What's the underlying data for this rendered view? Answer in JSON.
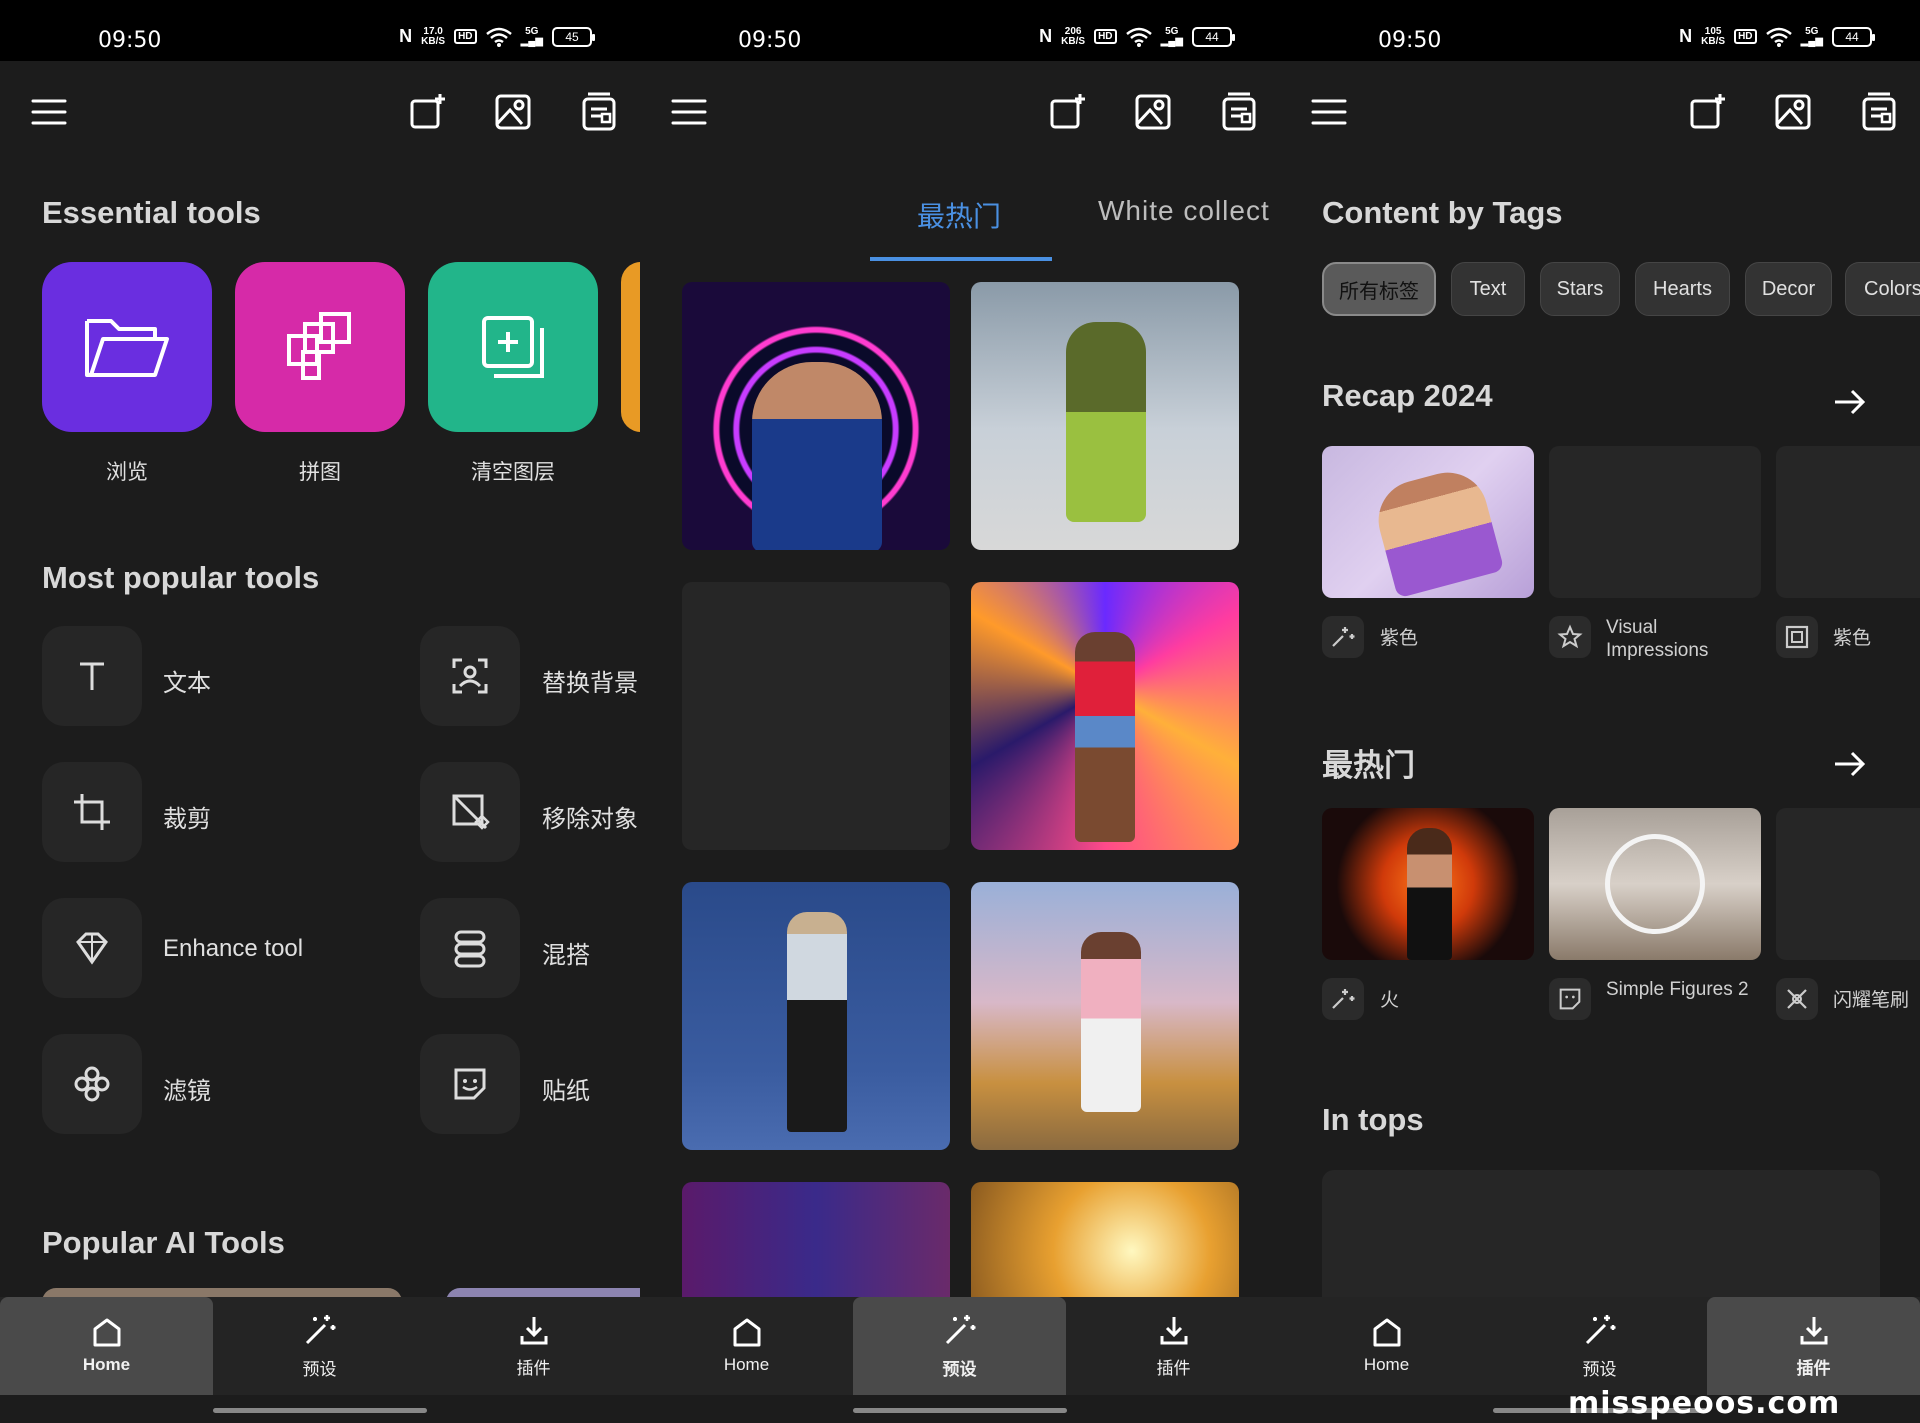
{
  "status_bars": [
    {
      "time": "09:50",
      "net_top": "17.0",
      "net_bottom": "KB/S",
      "battery": "45"
    },
    {
      "time": "09:50",
      "net_top": "206",
      "net_bottom": "KB/S",
      "battery": "44"
    },
    {
      "time": "09:50",
      "net_top": "105",
      "net_bottom": "KB/S",
      "battery": "44"
    }
  ],
  "status_labels": {
    "hd": "HD",
    "signal": "5G",
    "nfc": "N"
  },
  "icons": {
    "menu": "menu-icon",
    "new": "new-project-icon",
    "open_image": "open-image-icon",
    "projects": "projects-icon",
    "home": "home-icon",
    "presets": "magic-wand-icon",
    "plugins": "download-icon"
  },
  "home": {
    "essential_title": "Essential tools",
    "essential": [
      {
        "label": "浏览",
        "color": "#6a2ee0",
        "icon": "folder-icon"
      },
      {
        "label": "拼图",
        "color": "#d62aa8",
        "icon": "collage-icon"
      },
      {
        "label": "清空图层",
        "color": "#22b58a",
        "icon": "add-layer-icon"
      }
    ],
    "popular_title": "Most popular tools",
    "popular": [
      {
        "label": "文本",
        "icon": "text-icon"
      },
      {
        "label": "替换背景",
        "icon": "replace-background-icon"
      },
      {
        "label": "裁剪",
        "icon": "crop-icon"
      },
      {
        "label": "移除对象",
        "icon": "remove-object-icon"
      },
      {
        "label": "Enhance tool",
        "icon": "enhance-diamond-icon"
      },
      {
        "label": "混搭",
        "icon": "blend-icon"
      },
      {
        "label": "滤镜",
        "icon": "filter-flower-icon"
      },
      {
        "label": "贴纸",
        "icon": "sticker-icon"
      }
    ],
    "ai_title": "Popular AI Tools"
  },
  "presets": {
    "tabs": [
      "最热门",
      "White collect"
    ],
    "active_tab": 0
  },
  "plugins": {
    "tags_title": "Content by Tags",
    "chips": [
      "所有标签",
      "Text",
      "Stars",
      "Hearts",
      "Decor",
      "Colors"
    ],
    "recap_title": "Recap 2024",
    "recap_items": [
      {
        "label": "紫色",
        "icon": "sparkle-icon"
      },
      {
        "label": "Visual Impressions",
        "icon": "star-icon"
      },
      {
        "label": "紫色",
        "icon": "frame-icon"
      }
    ],
    "hot_title": "最热门",
    "hot_items": [
      {
        "label": "火",
        "icon": "sparkle-icon"
      },
      {
        "label": "Simple Figures 2",
        "icon": "sticker-icon"
      },
      {
        "label": "闪耀笔刷",
        "icon": "brush-icon"
      }
    ],
    "tops_title": "In tops"
  },
  "nav": {
    "home": "Home",
    "presets": "预设",
    "plugins": "插件"
  },
  "watermark": "misspeoos.com"
}
